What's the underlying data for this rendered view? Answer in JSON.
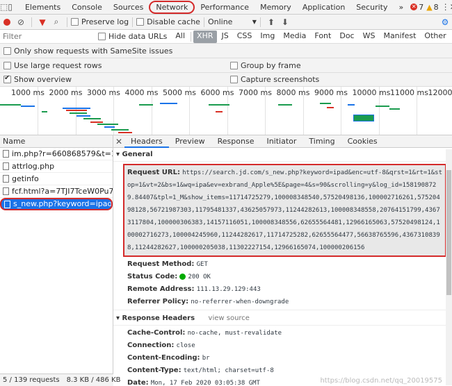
{
  "tabs": [
    "Elements",
    "Console",
    "Sources",
    "Network",
    "Performance",
    "Memory",
    "Application",
    "Security"
  ],
  "tabs_more": "»",
  "errors": "7",
  "warnings": "8",
  "toolbar": {
    "preserve_log": "Preserve log",
    "disable_cache": "Disable cache",
    "throttle": "Online"
  },
  "filter": {
    "placeholder": "Filter",
    "hide_data_urls": "Hide data URLs",
    "types": [
      "All",
      "XHR",
      "JS",
      "CSS",
      "Img",
      "Media",
      "Font",
      "Doc",
      "WS",
      "Manifest",
      "Other"
    ],
    "active_type": "XHR"
  },
  "options": {
    "samesite": "Only show requests with SameSite issues",
    "large_rows": "Use large request rows",
    "group_frame": "Group by frame",
    "show_overview": "Show overview",
    "capture_screens": "Capture screenshots"
  },
  "overview_ticks": [
    "1000 ms",
    "2000 ms",
    "3000 ms",
    "4000 ms",
    "5000 ms",
    "6000 ms",
    "7000 ms",
    "8000 ms",
    "9000 ms",
    "10000 ms",
    "11000 ms",
    "12000"
  ],
  "list": {
    "header": "Name",
    "items": [
      "im.php?r=660868579&t=1581...",
      "attrlog.php",
      "getinfo",
      "fcf.html?a=7TJI7TceW0Pu7Tce...",
      "s_new.php?keyword=ipad&en..."
    ],
    "selected_index": 4
  },
  "status": {
    "requests": "5 / 139 requests",
    "size": "8.3 KB / 486 KB"
  },
  "detail_tabs": [
    "Headers",
    "Preview",
    "Response",
    "Initiator",
    "Timing",
    "Cookies"
  ],
  "general": {
    "title": "General",
    "request_url_label": "Request URL:",
    "request_url": "https://search.jd.com/s_new.php?keyword=ipad&enc=utf-8&qrst=1&rt=1&stop=1&vt=2&bs=1&wq=ipa&ev=exbrand_Apple%5E&page=4&s=90&scrolling=y&log_id=1581908729.84407&tpl=1_M&show_items=11714725279,100008348540,57520498136,100002716261,57520498128,56721987303,11795481337,43625057973,11244282613,100008348558,20764151799,43673117804,100000306383,14157116051,100008348556,62655564481,12966165063,57520498124,100002716273,100004245960,11244282617,11714725282,62655564477,56638765596,43673108398,11244282627,100000205038,11302227154,12966165074,100000206156",
    "method_label": "Request Method:",
    "method": "GET",
    "status_label": "Status Code:",
    "status": "200 OK",
    "remote_label": "Remote Address:",
    "remote": "111.13.29.129:443",
    "referrer_label": "Referrer Policy:",
    "referrer": "no-referrer-when-downgrade"
  },
  "response_headers": {
    "title": "Response Headers",
    "view_source": "view source",
    "items": [
      {
        "k": "Cache-Control:",
        "v": "no-cache, must-revalidate"
      },
      {
        "k": "Connection:",
        "v": "close"
      },
      {
        "k": "Content-Encoding:",
        "v": "br"
      },
      {
        "k": "Content-Type:",
        "v": "text/html; charset=utf-8"
      },
      {
        "k": "Date:",
        "v": "Mon, 17 Feb 2020 03:05:38 GMT"
      }
    ]
  },
  "watermark": "https://blog.csdn.net/qq_20019575"
}
